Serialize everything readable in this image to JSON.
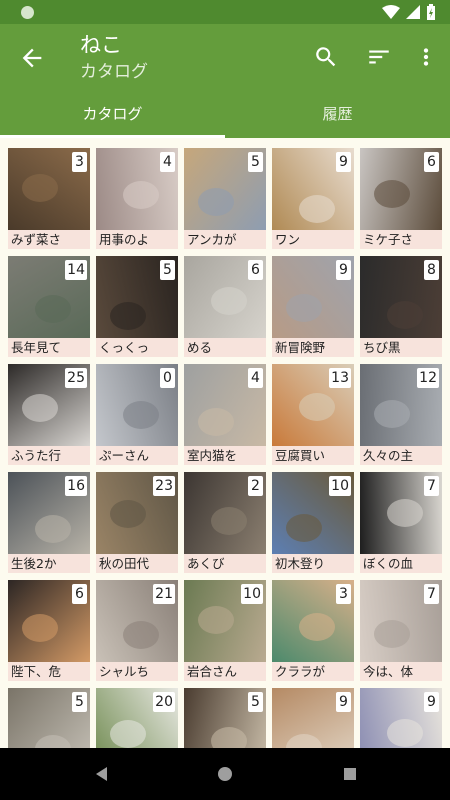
{
  "app_bar": {
    "title": "ねこ",
    "subtitle": "カタログ"
  },
  "tabs": [
    {
      "label": "カタログ",
      "active": true
    },
    {
      "label": "履歴",
      "active": false
    }
  ],
  "colors": {
    "primary": "#649d3c",
    "status_bar": "#4f8a2f",
    "label_bg": "#f7e3dc",
    "background": "#fdfbef"
  },
  "icons": {
    "back": "arrow-back-icon",
    "search": "search-icon",
    "sort": "sort-icon",
    "more": "more-vert-icon"
  },
  "cats": [
    {
      "name": "みず菜さ",
      "count": "3",
      "tone": [
        "#4a3a2a",
        "#8b6b4a"
      ]
    },
    {
      "name": "用事のよ",
      "count": "4",
      "tone": [
        "#9c8a86",
        "#d8ccc6"
      ]
    },
    {
      "name": "アンカが",
      "count": "5",
      "tone": [
        "#c6a77b",
        "#8e9db1"
      ]
    },
    {
      "name": "ワン",
      "count": "9",
      "tone": [
        "#b08a54",
        "#e8dccf"
      ]
    },
    {
      "name": "ミケ子さ",
      "count": "6",
      "tone": [
        "#c9c5c2",
        "#5b4b3a"
      ]
    },
    {
      "name": "長年見て",
      "count": "14",
      "tone": [
        "#7c7c74",
        "#5a6a58"
      ]
    },
    {
      "name": "くっくっ",
      "count": "5",
      "tone": [
        "#5a4a3c",
        "#2a2420"
      ]
    },
    {
      "name": "める",
      "count": "6",
      "tone": [
        "#a9a69f",
        "#d6d3cc"
      ]
    },
    {
      "name": "新冒険野",
      "count": "9",
      "tone": [
        "#b79b86",
        "#9fa3ac"
      ]
    },
    {
      "name": "ちび黒",
      "count": "8",
      "tone": [
        "#2b2b2b",
        "#4c3e36"
      ]
    },
    {
      "name": "ふうた行",
      "count": "25",
      "tone": [
        "#2d2a28",
        "#d9d6d2"
      ]
    },
    {
      "name": "ぷーさん",
      "count": "0",
      "tone": [
        "#c4c7cc",
        "#7b7f86"
      ]
    },
    {
      "name": "室内猫を",
      "count": "4",
      "tone": [
        "#9ea0a0",
        "#c8b9a5"
      ]
    },
    {
      "name": "豆腐買い",
      "count": "13",
      "tone": [
        "#c97a3a",
        "#d9cdb8"
      ]
    },
    {
      "name": "久々の主",
      "count": "12",
      "tone": [
        "#6a6e74",
        "#a9adb2"
      ]
    },
    {
      "name": "生後2か",
      "count": "16",
      "tone": [
        "#4c5258",
        "#b8b3a8"
      ]
    },
    {
      "name": "秋の田代",
      "count": "23",
      "tone": [
        "#9a8466",
        "#5f5646"
      ]
    },
    {
      "name": "あくび",
      "count": "2",
      "tone": [
        "#3c3632",
        "#8b7f70"
      ]
    },
    {
      "name": "初木登り",
      "count": "10",
      "tone": [
        "#5d7fb3",
        "#6a5a3a"
      ]
    },
    {
      "name": "ぼくの血",
      "count": "7",
      "tone": [
        "#1e1e1e",
        "#d9d6d0"
      ]
    },
    {
      "name": "陛下、危",
      "count": "6",
      "tone": [
        "#2d2624",
        "#d39a66"
      ]
    },
    {
      "name": "シャルち",
      "count": "21",
      "tone": [
        "#c9c1b7",
        "#8a8078"
      ]
    },
    {
      "name": "岩合さん",
      "count": "10",
      "tone": [
        "#6b7a52",
        "#b9aa90"
      ]
    },
    {
      "name": "クララが",
      "count": "3",
      "tone": [
        "#4c8a6c",
        "#d8b08a"
      ]
    },
    {
      "name": "今は、体",
      "count": "7",
      "tone": [
        "#d8cec6",
        "#a89f98"
      ]
    },
    {
      "name": "",
      "count": "5",
      "tone": [
        "#7a7468",
        "#c5c0b6"
      ]
    },
    {
      "name": "",
      "count": "20",
      "tone": [
        "#6f8a4f",
        "#e8e8e2"
      ]
    },
    {
      "name": "",
      "count": "5",
      "tone": [
        "#4a3c30",
        "#c8bca8"
      ]
    },
    {
      "name": "",
      "count": "9",
      "tone": [
        "#b58a64",
        "#e2d6c6"
      ]
    },
    {
      "name": "",
      "count": "9",
      "tone": [
        "#8a8cb2",
        "#e8e4dc"
      ]
    }
  ]
}
